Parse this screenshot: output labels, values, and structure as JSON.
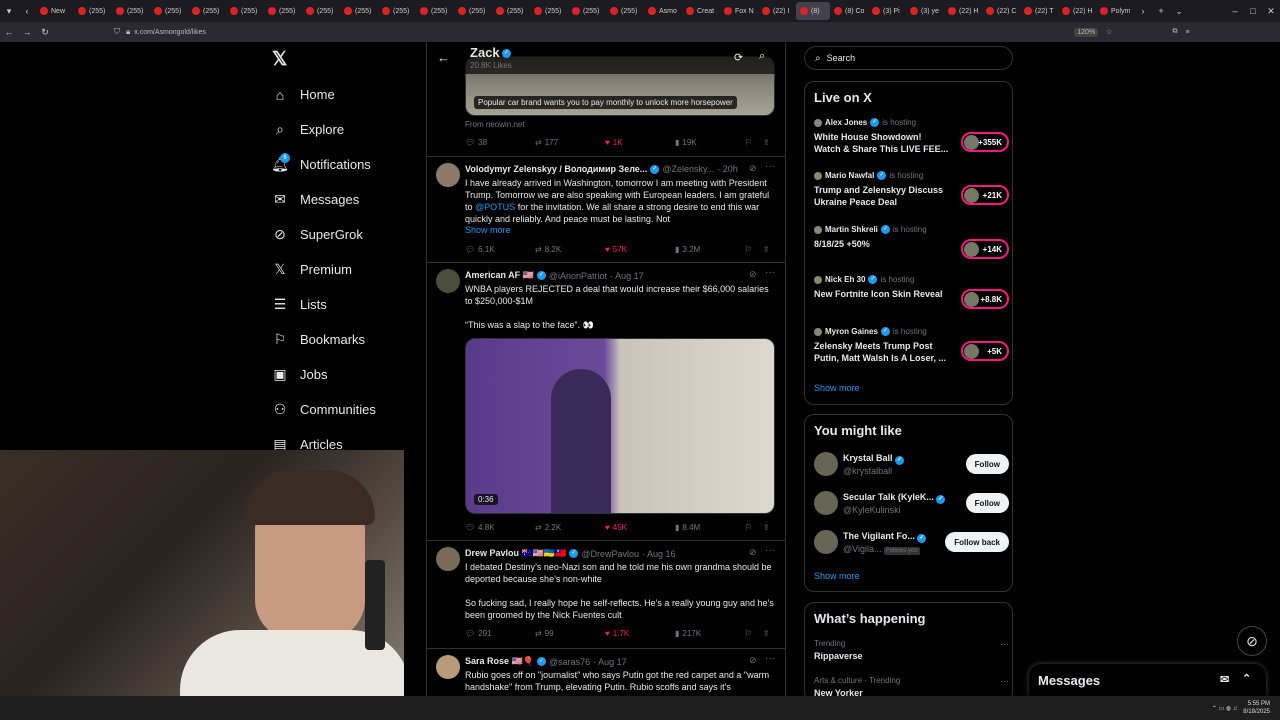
{
  "browser": {
    "tabs": [
      {
        "label": "New"
      },
      {
        "label": "(255)"
      },
      {
        "label": "(255)"
      },
      {
        "label": "(255)"
      },
      {
        "label": "(255)"
      },
      {
        "label": "(255)"
      },
      {
        "label": "(255)"
      },
      {
        "label": "(255)"
      },
      {
        "label": "(255)"
      },
      {
        "label": "(255)"
      },
      {
        "label": "(255)"
      },
      {
        "label": "(255)"
      },
      {
        "label": "(255)"
      },
      {
        "label": "(255)"
      },
      {
        "label": "(255)"
      },
      {
        "label": "(255)"
      },
      {
        "label": "Asmo"
      },
      {
        "label": "Creat"
      },
      {
        "label": "Fox N"
      },
      {
        "label": "(22) I"
      },
      {
        "label": "(8)"
      },
      {
        "label": "(8) Co"
      },
      {
        "label": "(3) Pi"
      },
      {
        "label": "(3) ye"
      },
      {
        "label": "(22) H"
      },
      {
        "label": "(22) C"
      },
      {
        "label": "(22) T"
      },
      {
        "label": "(22) H"
      },
      {
        "label": "Polym"
      }
    ],
    "url": "x.com/Asmongold/likes",
    "zoom": "120%"
  },
  "nav": {
    "items": [
      {
        "label": "Home",
        "icon": "home-icon"
      },
      {
        "label": "Explore",
        "icon": "search-icon"
      },
      {
        "label": "Notifications",
        "icon": "bell-icon"
      },
      {
        "label": "Messages",
        "icon": "mail-icon"
      },
      {
        "label": "SuperGrok",
        "icon": "grok-icon"
      },
      {
        "label": "Premium",
        "icon": "x-logo-icon"
      },
      {
        "label": "Lists",
        "icon": "list-icon"
      },
      {
        "label": "Bookmarks",
        "icon": "bookmark-icon"
      },
      {
        "label": "Jobs",
        "icon": "briefcase-icon"
      },
      {
        "label": "Communities",
        "icon": "people-icon"
      },
      {
        "label": "Articles",
        "icon": "article-icon"
      }
    ],
    "notification_badge": "6"
  },
  "profile_header": {
    "name": "Zack",
    "likes": "20.8K Likes"
  },
  "tweets": [
    {
      "media_caption": "Popular car brand wants you to pay monthly to unlock more horsepower",
      "source": "From neowin.net",
      "replies": "38",
      "reposts": "177",
      "likes": "1K",
      "views": "19K"
    },
    {
      "name": "Volodymyr Zelenskyy / Володимир Зеле...",
      "handle": "@Zelensky...",
      "time": "· 20h",
      "text": "I have already arrived in Washington, tomorrow I am meeting with President Trump. Tomorrow we are also speaking with European leaders. I am grateful to",
      "mention": "@POTUS",
      "text2": "for the invitation. We all share a strong desire to end this war quickly and reliably. And peace must be lasting. Not",
      "show_more": "Show more",
      "replies": "6.1K",
      "reposts": "8.2K",
      "likes": "57K",
      "views": "3.2M"
    },
    {
      "name": "American AF 🇺🇸",
      "handle": "@iAnonPatriot",
      "time": "· Aug 17",
      "text": "WNBA players REJECTED a deal that would increase their $66,000 salaries to $250,000-$1M",
      "text2": "“This was a slap to the face”. 👀",
      "video_duration": "0:36",
      "replies": "4.8K",
      "reposts": "2.2K",
      "likes": "45K",
      "views": "8.4M"
    },
    {
      "name": "Drew Pavlou 🇦🇺🇺🇸🇺🇦🇹🇼",
      "handle": "@DrewPavlou",
      "time": "· Aug 16",
      "text": "I debated Destiny’s neo-Nazi son and he told me his own grandma should be deported because she’s non-white",
      "text2": "So fucking sad, I really hope he self-reflects. He’s a really young guy and he’s been groomed by the Nick Fuentes cult",
      "replies": "291",
      "reposts": "99",
      "likes": "1.7K",
      "views": "217K"
    },
    {
      "name": "Sara Rose 🇺🇸🎈",
      "handle": "@saras76",
      "time": "· Aug 17",
      "text": "Rubio goes off on \"journalist\" who says Putin got the red carpet and a \"warm handshake\" from Trump, elevating Putin. Rubio scoffs and says it's"
    }
  ],
  "search": {
    "placeholder": "Search"
  },
  "live": {
    "title": "Live on X",
    "is_hosting": "is hosting",
    "items": [
      {
        "host": "Alex Jones",
        "title": "White House Showdown! Watch & Share This LIVE FEE...",
        "count": "+355K"
      },
      {
        "host": "Mario Nawfal",
        "title": "Trump and Zelenskyy Discuss Ukraine Peace Deal",
        "count": "+21K"
      },
      {
        "host": "Martin Shkreli",
        "title": "8/18/25 +50%",
        "count": "+14K"
      },
      {
        "host": "Nick Eh 30",
        "title": "New Fortnite Icon Skin Reveal",
        "count": "+8.8K"
      },
      {
        "host": "Myron Gaines",
        "title": "Zelensky Meets Trump Post Putin, Matt Walsh Is A Loser, ...",
        "count": "+5K"
      }
    ],
    "show_more": "Show more"
  },
  "you_might_like": {
    "title": "You might like",
    "items": [
      {
        "name": "Krystal Ball",
        "handle": "@krystalball",
        "button": "Follow"
      },
      {
        "name": "Secular Talk (KyleK...",
        "handle": "@KyleKulinski",
        "button": "Follow"
      },
      {
        "name": "The Vigilant Fo...",
        "handle": "@Vigila...",
        "follows_you": "Follows you",
        "button": "Follow back"
      }
    ],
    "show_more": "Show more"
  },
  "whats_happening": {
    "title": "What’s happening",
    "items": [
      {
        "context": "Trending",
        "topic": "Rippaverse"
      },
      {
        "context": "Arts & culture · Trending",
        "topic": "New Yorker"
      }
    ]
  },
  "messages_dock": {
    "title": "Messages"
  },
  "taskbar": {
    "time": "5:55 PM",
    "date": "8/18/2025"
  },
  "colors": {
    "accent": "#1d9bf0",
    "like": "#f91880",
    "background": "#000000"
  }
}
